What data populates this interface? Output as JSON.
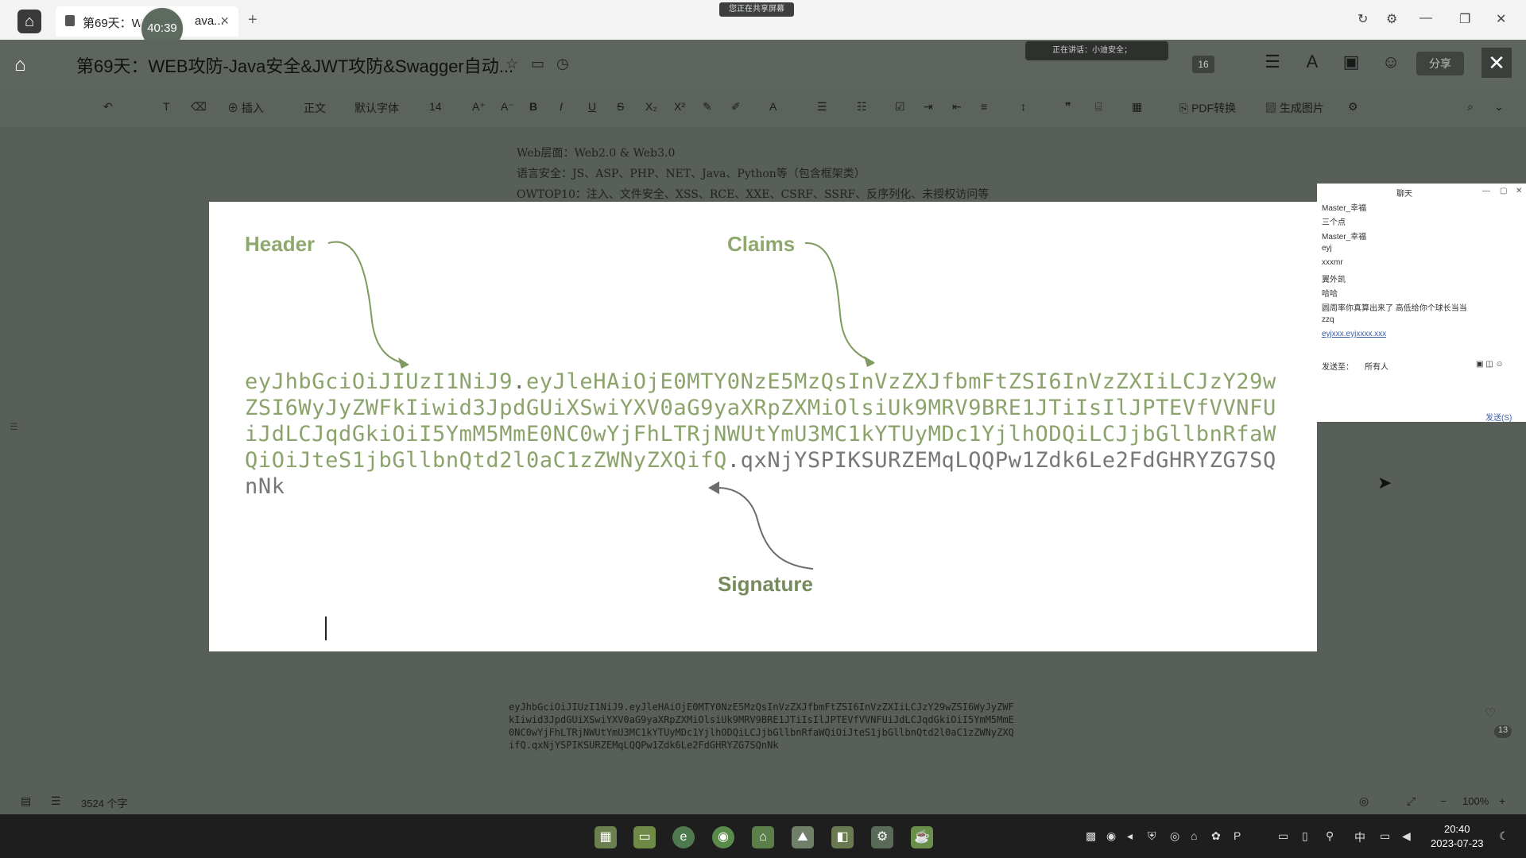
{
  "titlebar": {
    "tab_title": "第69天：W",
    "tab_title_tail": "ava...",
    "timer": "40:39",
    "share_badge": "您正在共享屏幕"
  },
  "header": {
    "doc_title": "第69天：WEB攻防-Java安全&JWT攻防&Swagger自动...",
    "meeting_text": "正在讲话：小迪安全；",
    "participants": "16",
    "share_button": "分享"
  },
  "toolbar": {
    "insert": "插入",
    "style": "正文",
    "font": "默认字体",
    "size": "14",
    "bold": "B",
    "italic": "I",
    "underline": "U",
    "strike": "S",
    "pdf": "PDF转换",
    "image": "生成图片"
  },
  "background_doc": {
    "line1": "Web层面：Web2.0 & Web3.0",
    "line2": "语言安全：JS、ASP、PHP、NET、Java、Python等（包含框架类）",
    "line3": "OWTOP10：注入、文件安全、XSS、RCE、XXE、CSRF、SSRF、反序列化、未授权访问等"
  },
  "jwt_figure": {
    "header_label": "Header",
    "claims_label": "Claims",
    "signature_label": "Signature",
    "part_header": "eyJhbGciOiJIUzI1NiJ9",
    "part_claims": "eyJleHAiOjE0MTY0NzE5MzQsInVzZXJfbmFtZSI6InVzZXIiLCJzY29wZSI6WyJyZWFkIiwid3JpdGUiXSwiYXV0aG9yaXRpZXMiOlsiUk9MRV9BRE1JTiIsIlJPTEVfVVNFUiJdLCJqdGkiOiI5YmM5MmE0NC0wYjFhLTRjNWUtYmU3MC1kYTUyMDc1YjlhODQiLCJjbGllbnRfaWQiOiJteS1jbGllbnQtd2l0aC1zZWNyZXQifQ",
    "part_signature": "qxNjYSPIKSURZEMqLQQPw1Zdk6Le2FdGHRYZG7SQnNk",
    "dot": "."
  },
  "chat": {
    "title": "聊天",
    "messages": [
      "Master_幸福",
      "三个点",
      "Master_幸福",
      "eyj",
      "xxxmr",
      "翼外凯",
      "哈哈",
      "圆周率你真算出来了 高低给你个球长当当",
      "zzq",
      "eyjxxx.eyjxxxx.xxx"
    ],
    "send_to_label": "发送至：",
    "send_to_value": "所有人",
    "send_button": "发送(S)"
  },
  "status": {
    "word_count": "3524 个字",
    "zoom": "100%",
    "chat_count": "13"
  },
  "clock": {
    "time": "20:40",
    "date": "2023-07-23"
  },
  "tray": {
    "ime": "中"
  }
}
